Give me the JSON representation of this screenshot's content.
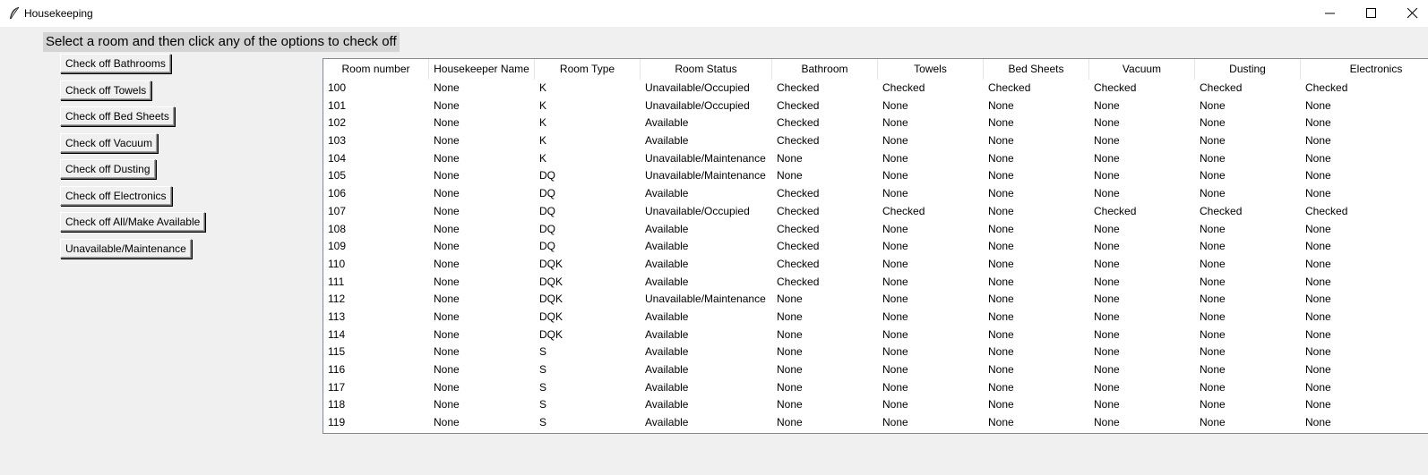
{
  "window": {
    "title": "Housekeeping",
    "icon": "feather-icon"
  },
  "instruction": "Select a room and then click any of the options to check off",
  "buttons": [
    "Check off Bathrooms",
    "Check off Towels",
    "Check off Bed Sheets",
    "Check off Vacuum",
    "Check off Dusting",
    "Check off Electronics",
    "Check off All/Make Available",
    "Unavailable/Maintenance"
  ],
  "table": {
    "columns": [
      "Room number",
      "Housekeeper Name",
      "Room Type",
      "Room Status",
      "Bathroom",
      "Towels",
      "Bed Sheets",
      "Vacuum",
      "Dusting",
      "Electronics"
    ],
    "rows": [
      [
        "100",
        "None",
        "K",
        "Unavailable/Occupied",
        "Checked",
        "Checked",
        "Checked",
        "Checked",
        "Checked",
        "Checked"
      ],
      [
        "101",
        "None",
        "K",
        "Unavailable/Occupied",
        "Checked",
        "None",
        "None",
        "None",
        "None",
        "None"
      ],
      [
        "102",
        "None",
        "K",
        "Available",
        "Checked",
        "None",
        "None",
        "None",
        "None",
        "None"
      ],
      [
        "103",
        "None",
        "K",
        "Available",
        "Checked",
        "None",
        "None",
        "None",
        "None",
        "None"
      ],
      [
        "104",
        "None",
        "K",
        "Unavailable/Maintenance",
        "None",
        "None",
        "None",
        "None",
        "None",
        "None"
      ],
      [
        "105",
        "None",
        "DQ",
        "Unavailable/Maintenance",
        "None",
        "None",
        "None",
        "None",
        "None",
        "None"
      ],
      [
        "106",
        "None",
        "DQ",
        "Available",
        "Checked",
        "None",
        "None",
        "None",
        "None",
        "None"
      ],
      [
        "107",
        "None",
        "DQ",
        "Unavailable/Occupied",
        "Checked",
        "Checked",
        "None",
        "Checked",
        "Checked",
        "Checked"
      ],
      [
        "108",
        "None",
        "DQ",
        "Available",
        "Checked",
        "None",
        "None",
        "None",
        "None",
        "None"
      ],
      [
        "109",
        "None",
        "DQ",
        "Available",
        "Checked",
        "None",
        "None",
        "None",
        "None",
        "None"
      ],
      [
        "110",
        "None",
        "DQK",
        "Available",
        "Checked",
        "None",
        "None",
        "None",
        "None",
        "None"
      ],
      [
        "111",
        "None",
        "DQK",
        "Available",
        "Checked",
        "None",
        "None",
        "None",
        "None",
        "None"
      ],
      [
        "112",
        "None",
        "DQK",
        "Unavailable/Maintenance",
        "None",
        "None",
        "None",
        "None",
        "None",
        "None"
      ],
      [
        "113",
        "None",
        "DQK",
        "Available",
        "None",
        "None",
        "None",
        "None",
        "None",
        "None"
      ],
      [
        "114",
        "None",
        "DQK",
        "Available",
        "None",
        "None",
        "None",
        "None",
        "None",
        "None"
      ],
      [
        "115",
        "None",
        "S",
        "Available",
        "None",
        "None",
        "None",
        "None",
        "None",
        "None"
      ],
      [
        "116",
        "None",
        "S",
        "Available",
        "None",
        "None",
        "None",
        "None",
        "None",
        "None"
      ],
      [
        "117",
        "None",
        "S",
        "Available",
        "None",
        "None",
        "None",
        "None",
        "None",
        "None"
      ],
      [
        "118",
        "None",
        "S",
        "Available",
        "None",
        "None",
        "None",
        "None",
        "None",
        "None"
      ],
      [
        "119",
        "None",
        "S",
        "Available",
        "None",
        "None",
        "None",
        "None",
        "None",
        "None"
      ]
    ]
  }
}
